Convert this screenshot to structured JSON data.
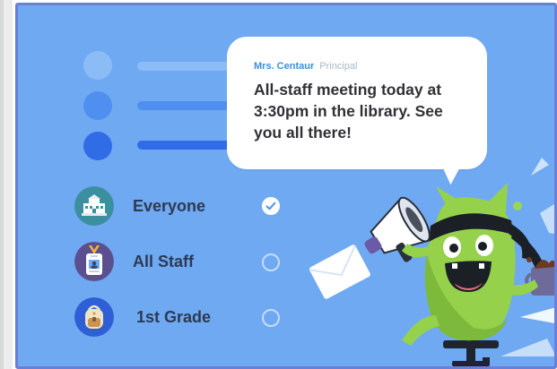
{
  "message": {
    "sender_name": "Mrs. Centaur",
    "sender_role": "Principal",
    "text": "All-staff meeting today at 3:30pm in the library. See you all there!"
  },
  "recipients": [
    {
      "label": "Everyone",
      "icon": "school-building-icon",
      "selected": true
    },
    {
      "label": "All Staff",
      "icon": "staff-badge-icon",
      "selected": false
    },
    {
      "label": "1st Grade",
      "icon": "backpack-icon",
      "selected": false
    }
  ],
  "illustration": {
    "icon": "green-monster-megaphone-icon"
  },
  "colors": {
    "panel_background": "#6fa9f2",
    "panel_border": "#6a7fd8",
    "accent": "#3d8ddd",
    "monster_green": "#96d14b"
  }
}
